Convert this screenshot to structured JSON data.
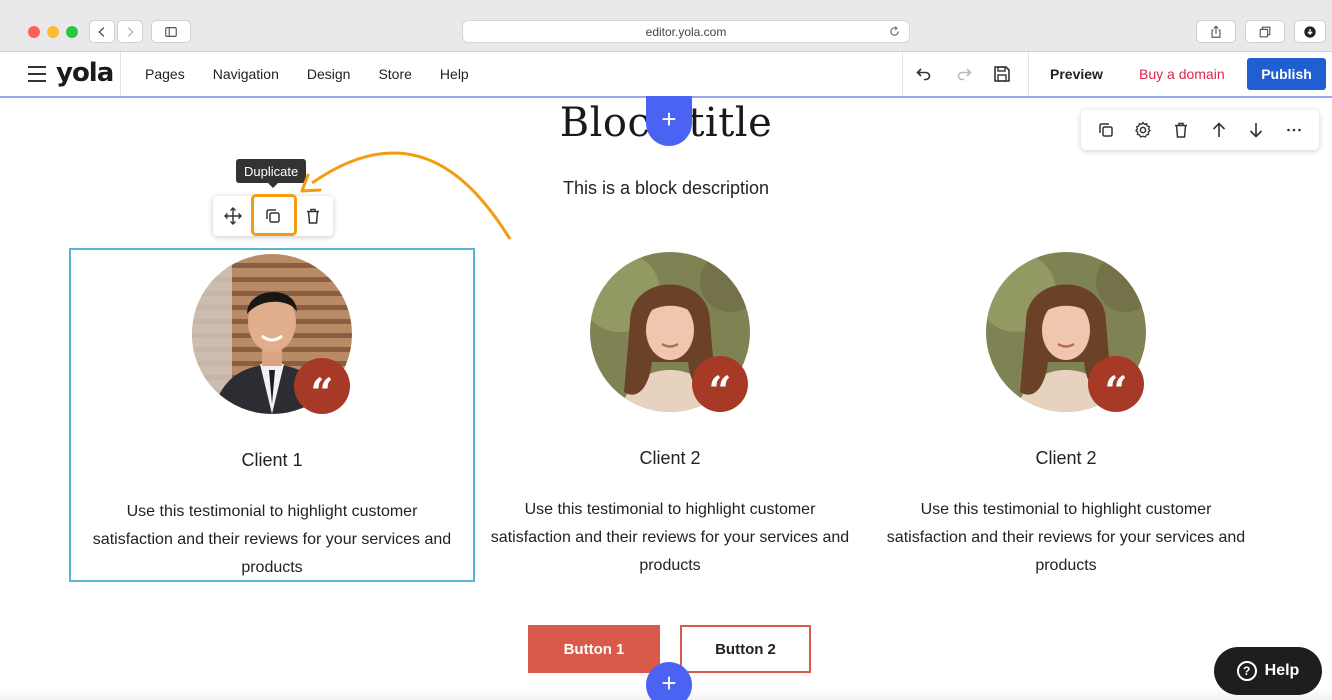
{
  "browser": {
    "url": "editor.yola.com"
  },
  "editor": {
    "logo": "yola",
    "menu": [
      "Pages",
      "Navigation",
      "Design",
      "Store",
      "Help"
    ],
    "preview_label": "Preview",
    "buy_domain_label": "Buy a domain",
    "publish_label": "Publish"
  },
  "block": {
    "title": "Block title",
    "description": "This is a block description"
  },
  "item_toolbar": {
    "tooltip": "Duplicate"
  },
  "testimonials": [
    {
      "name": "Client 1",
      "text": "Use this testimonial to highlight customer satisfaction and their reviews for your services and products",
      "quote_mark": "“"
    },
    {
      "name": "Client 2",
      "text": "Use this testimonial to highlight customer satisfaction and their reviews for your services and products",
      "quote_mark": "“"
    },
    {
      "name": "Client 2",
      "text": "Use this testimonial to highlight customer satisfaction and their reviews for your services and products",
      "quote_mark": "“"
    }
  ],
  "buttons": {
    "button1": "Button 1",
    "button2": "Button 2"
  },
  "help": {
    "label": "Help",
    "icon_glyph": "?"
  },
  "add_glyph": "+",
  "colors": {
    "publish": "#1f5fd1",
    "buy_domain": "#e0254f",
    "add_button": "#4a63f2",
    "quote_badge": "#a73a26",
    "button1": "#d75a4a",
    "selection_border": "#5bb4d4",
    "highlight": "#f39c12"
  },
  "icons": {
    "chrome": [
      "back-icon",
      "forward-icon",
      "sidebar-icon",
      "reload-icon",
      "share-icon",
      "tabs-icon",
      "download-icon"
    ],
    "editor": [
      "menu-icon",
      "undo-icon",
      "redo-icon",
      "save-icon"
    ],
    "block_toolbar": [
      "duplicate-icon",
      "settings-icon",
      "delete-icon",
      "move-up-icon",
      "move-down-icon",
      "more-icon"
    ],
    "item_toolbar": [
      "move-icon",
      "duplicate-icon",
      "delete-icon"
    ]
  }
}
